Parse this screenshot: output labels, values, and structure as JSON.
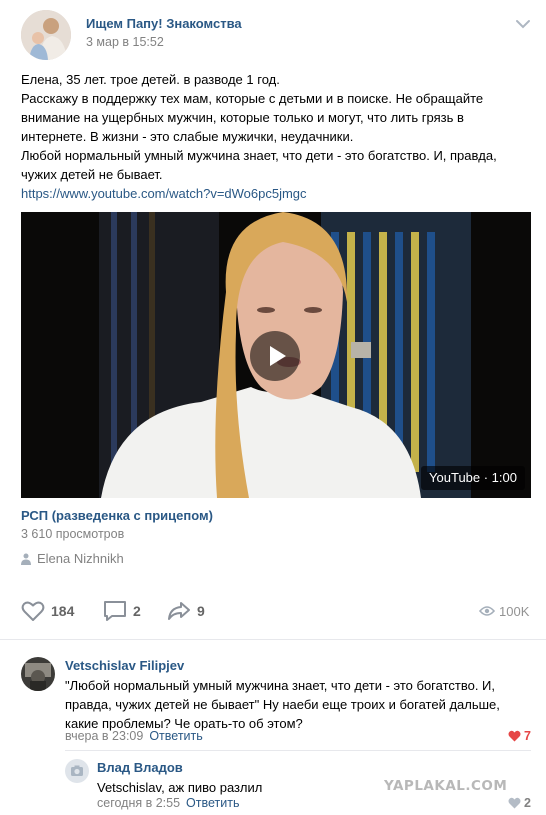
{
  "post": {
    "group_name": "Ищем Папу! Знакомства",
    "date": "3 мар в 15:52",
    "text_lines": [
      "Елена, 35 лет. трое детей. в разводе 1 год.",
      "Расскажу в поддержку тех мам, которые с детьми и в поиске. Не обращайте",
      "внимание на ущербных мужчин, которые только и могут, что лить грязь в",
      "интернете. В жизни - это слабые мужички, неудачники.",
      "Любой нормальный умный мужчина знает, что дети - это богатство. И, правда,",
      "чужих детей не бывает."
    ],
    "link": "https://www.youtube.com/watch?v=dWo6pc5jmgc",
    "video": {
      "badge": "YouTube · 1:00",
      "title": "РСП (разведенка с прицепом)",
      "views": "3 610 просмотров",
      "author": "Elena Nizhnikh"
    },
    "actions": {
      "likes": "184",
      "comments": "2",
      "shares": "9",
      "views": "100K"
    }
  },
  "comments": [
    {
      "author": "Vetschislav Filipjev",
      "text_lines": [
        "\"Любой нормальный умный мужчина знает, что дети - это богатство. И,",
        "правда, чужих детей не бывает\" Ну наеби еще троих и богатей дальше,",
        "какие проблемы? Че орать-то об этом?"
      ],
      "time": "вчера в 23:09",
      "reply_label": "Ответить",
      "likes": "7",
      "liked": true
    },
    {
      "author": "Влад Владов",
      "text_lines": [
        "Vetschislav, аж пиво разлил"
      ],
      "time": "сегодня в 2:55",
      "reply_label": "Ответить",
      "likes": "2",
      "liked": false
    }
  ],
  "watermark": "YAPLAKAL.COM",
  "colors": {
    "link": "#2a5885",
    "muted": "#828282",
    "like_red": "#e64646",
    "icon_gray": "#8a9099"
  }
}
